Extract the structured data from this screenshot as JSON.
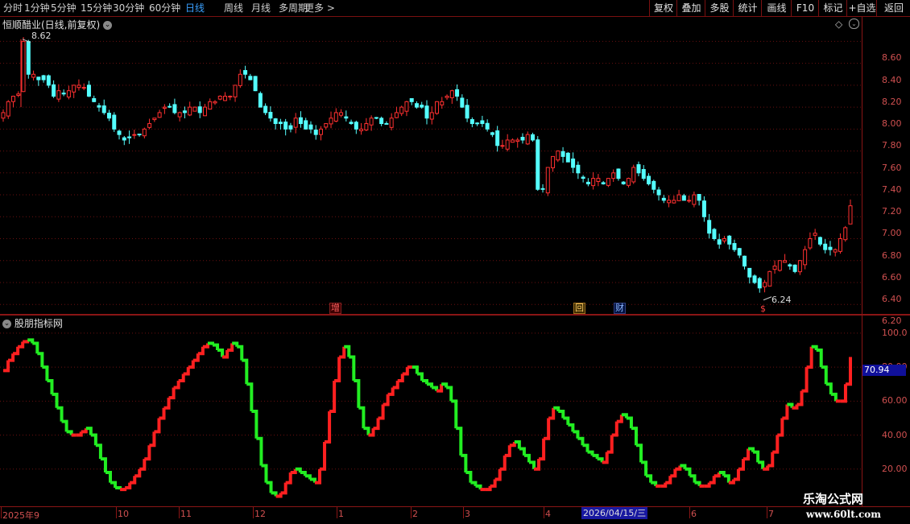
{
  "toolbar": {
    "periods": [
      "分时",
      "1分钟",
      "5分钟",
      "15分钟",
      "30分钟",
      "60分钟",
      "日线",
      "周线",
      "月线",
      "多周期",
      "更多 >"
    ],
    "active_period": "日线",
    "right_buttons": [
      "复权",
      "叠加",
      "多股",
      "统计",
      "画线",
      "F10",
      "标记",
      "+自选",
      "返回"
    ]
  },
  "main_chart": {
    "title": "恒顺醋业(日线,前复权)",
    "high_label": "8.62",
    "low_label": "6.24",
    "markers": [
      "增",
      "回",
      "财",
      "$"
    ]
  },
  "sub_chart": {
    "title": "股朋指标网",
    "current_value": "70.94"
  },
  "dates": {
    "labels": [
      "2025年9",
      "10",
      "11",
      "12",
      "1",
      "2",
      "3",
      "4",
      "6",
      "7"
    ],
    "cursor_date": "2026/04/15/三"
  },
  "watermark": {
    "line1": "乐淘公式网",
    "line2": "www.60lt.com"
  },
  "colors": {
    "up": "#ff3030",
    "down": "#54ffff",
    "ind_up": "#ff2020",
    "ind_down": "#22ee22",
    "grid": "#6a1010",
    "axis_text": "#d05050"
  },
  "chart_data": [
    {
      "type": "candlestick",
      "title": "恒顺醋业(日线,前复权)",
      "ylim": [
        6.15,
        8.75
      ],
      "yticks": [
        6.2,
        6.4,
        6.6,
        6.8,
        7.0,
        7.2,
        7.4,
        7.6,
        7.8,
        8.0,
        8.2,
        8.4,
        8.6
      ],
      "ytick_labels": [
        "6.20",
        "6.40",
        "6.60",
        "6.80",
        "7.00",
        "7.20",
        "7.40",
        "7.60",
        "7.80",
        "8.00",
        "8.20",
        "8.40",
        "8.60"
      ],
      "close": [
        7.95,
        8.05,
        8.1,
        8.12,
        8.6,
        8.3,
        8.3,
        8.25,
        8.25,
        8.2,
        8.1,
        8.15,
        8.12,
        8.15,
        8.2,
        8.2,
        8.18,
        8.1,
        8.05,
        8.0,
        7.95,
        7.9,
        7.8,
        7.75,
        7.7,
        7.72,
        7.75,
        7.75,
        7.8,
        7.85,
        7.9,
        7.95,
        8.0,
        8.0,
        7.95,
        7.95,
        7.95,
        8.0,
        8.0,
        7.95,
        8.0,
        8.05,
        8.05,
        8.1,
        8.1,
        8.1,
        8.2,
        8.3,
        8.3,
        8.25,
        8.15,
        8.0,
        7.95,
        7.9,
        7.85,
        7.85,
        7.8,
        7.8,
        7.9,
        7.85,
        7.8,
        7.8,
        7.75,
        7.8,
        7.85,
        7.9,
        7.95,
        7.95,
        7.9,
        7.85,
        7.8,
        7.8,
        7.85,
        7.9,
        7.9,
        7.85,
        7.85,
        7.9,
        7.95,
        8.0,
        8.05,
        8.05,
        8.0,
        8.0,
        7.9,
        7.95,
        8.05,
        8.05,
        8.1,
        8.15,
        8.1,
        8.0,
        7.9,
        7.85,
        7.85,
        7.85,
        7.8,
        7.75,
        7.65,
        7.65,
        7.7,
        7.7,
        7.7,
        7.7,
        7.75,
        7.7,
        7.25,
        7.25,
        7.45,
        7.55,
        7.6,
        7.55,
        7.5,
        7.45,
        7.4,
        7.35,
        7.3,
        7.35,
        7.35,
        7.3,
        7.35,
        7.4,
        7.35,
        7.3,
        7.35,
        7.45,
        7.4,
        7.35,
        7.3,
        7.25,
        7.2,
        7.15,
        7.15,
        7.15,
        7.2,
        7.15,
        7.15,
        7.2,
        7.15,
        7.0,
        6.85,
        6.8,
        6.75,
        6.8,
        6.75,
        6.7,
        6.65,
        6.55,
        6.45,
        6.4,
        6.35,
        6.4,
        6.5,
        6.55,
        6.6,
        6.6,
        6.55,
        6.5,
        6.6,
        6.7,
        6.8,
        6.85,
        6.75,
        6.7,
        6.7,
        6.7,
        6.8,
        6.9,
        7.1
      ],
      "high": 8.62,
      "low": 6.24,
      "up_color": "#ff3030",
      "down_color": "#54ffff"
    },
    {
      "type": "line",
      "title": "股朋指标网",
      "ylim": [
        0,
        108
      ],
      "yticks": [
        20,
        40,
        60,
        80,
        100
      ],
      "ytick_labels": [
        "20.00",
        "40.00",
        "60.00",
        "80.00",
        "100.0"
      ],
      "values": [
        78,
        84,
        88,
        92,
        95,
        96,
        94,
        88,
        80,
        72,
        64,
        56,
        48,
        42,
        40,
        40,
        42,
        44,
        40,
        34,
        26,
        18,
        12,
        9,
        8,
        9,
        12,
        16,
        20,
        26,
        34,
        42,
        50,
        56,
        62,
        68,
        72,
        76,
        80,
        84,
        88,
        92,
        94,
        93,
        90,
        86,
        90,
        94,
        92,
        84,
        70,
        54,
        38,
        22,
        12,
        6,
        4,
        6,
        12,
        18,
        20,
        18,
        16,
        14,
        12,
        20,
        36,
        54,
        72,
        86,
        92,
        86,
        72,
        56,
        44,
        40,
        44,
        50,
        58,
        64,
        68,
        72,
        76,
        80,
        80,
        76,
        72,
        70,
        68,
        66,
        70,
        68,
        60,
        44,
        28,
        18,
        12,
        10,
        8,
        8,
        10,
        14,
        20,
        28,
        34,
        36,
        32,
        28,
        24,
        20,
        26,
        38,
        50,
        56,
        54,
        50,
        46,
        42,
        38,
        34,
        30,
        28,
        26,
        24,
        30,
        40,
        48,
        52,
        50,
        44,
        34,
        24,
        16,
        12,
        10,
        10,
        12,
        16,
        20,
        22,
        20,
        16,
        12,
        10,
        10,
        12,
        16,
        18,
        16,
        12,
        14,
        20,
        26,
        32,
        30,
        24,
        20,
        22,
        30,
        40,
        50,
        58,
        56,
        58,
        66,
        80,
        92,
        90,
        80,
        70,
        64,
        60,
        60,
        70,
        86
      ],
      "up_color": "#ff2020",
      "down_color": "#22ee22"
    }
  ]
}
